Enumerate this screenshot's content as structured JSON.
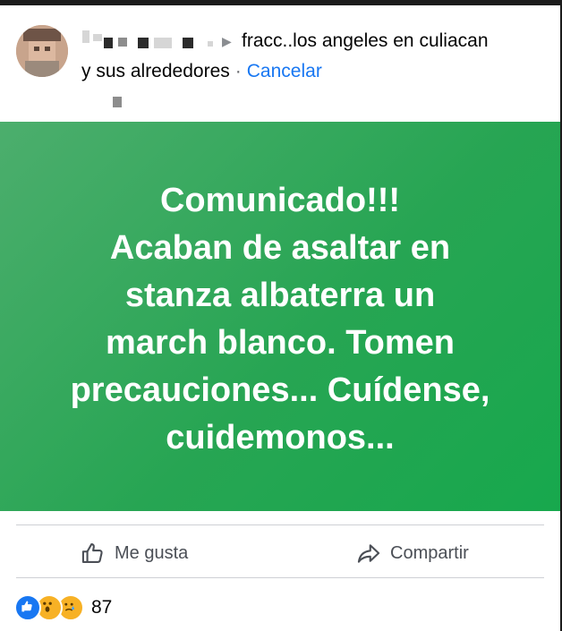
{
  "header": {
    "group_line1": "fracc..los angeles en culiacan",
    "group_line2": "y sus alrededores",
    "separator": "·",
    "cancel_label": "Cancelar",
    "arrow": "▶"
  },
  "post": {
    "lines": [
      "Comunicado!!!",
      "Acaban de asaltar en",
      "stanza albaterra un",
      "march blanco. Tomen",
      "precauciones... Cuídense,",
      "cuidemonos..."
    ],
    "background_color": "#27a553"
  },
  "actions": {
    "like_label": "Me gusta",
    "share_label": "Compartir"
  },
  "reactions": {
    "icons": [
      "like-icon",
      "wow-icon",
      "sad-icon"
    ],
    "count": "87"
  },
  "colors": {
    "link": "#1877f2",
    "secondary_text": "#65676b"
  }
}
